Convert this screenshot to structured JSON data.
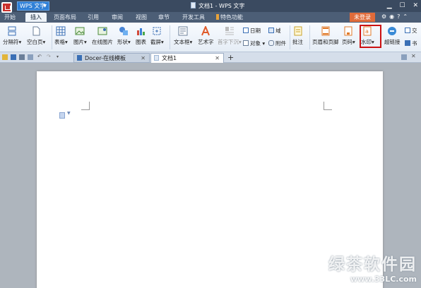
{
  "titlebar": {
    "app_menu_label": "WPS 文字",
    "window_title": "文档1 - WPS 文字"
  },
  "tabbar": {
    "tabs": [
      "开始",
      "插入",
      "页面布局",
      "引用",
      "审阅",
      "视图",
      "章节",
      "开发工具",
      "特色功能"
    ],
    "active_tab": "插入",
    "login_label": "未登录"
  },
  "ribbon": {
    "page_break": "分隔符",
    "blank_page": "空白页",
    "table": "表格",
    "picture": "图片",
    "online_picture": "在线图片",
    "shapes": "形状",
    "chart": "图表",
    "screenshot": "截屏",
    "text_box": "文本框",
    "word_art": "艺术字",
    "drop_cap": "首字下沉",
    "date": "日期",
    "field": "域",
    "object": "对象",
    "attachment": "附件",
    "comment": "批注",
    "header_footer": "页眉和页脚",
    "page_number": "页码",
    "watermark": "水印",
    "hyperlink": "超链接",
    "more1": "交",
    "more2": "书"
  },
  "doc_tabs": [
    {
      "label": "Docer-在线模板"
    },
    {
      "label": "文档1"
    }
  ],
  "site_watermark": {
    "logo": "绿茶软件园",
    "url": "www.33LC.com"
  },
  "colors": {
    "title_bg": "#3a4a60",
    "tab_bg": "#4c5e76",
    "login_btn": "#e06b3a",
    "highlight": "#cc1111",
    "canvas": "#aeb5bd"
  }
}
